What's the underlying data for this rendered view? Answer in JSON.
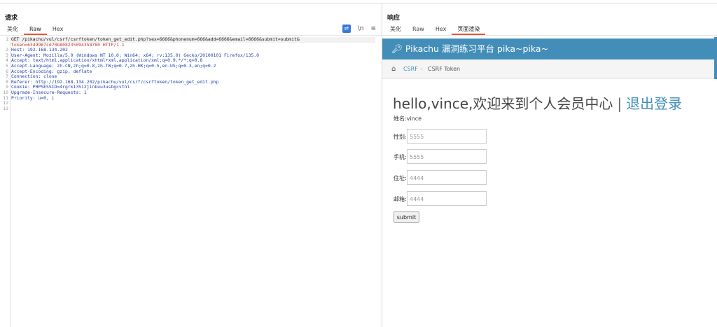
{
  "request": {
    "title": "请求",
    "tabs": [
      "美化",
      "Raw",
      "Hex"
    ],
    "active_tab": "Raw",
    "tool_newline": "\\n",
    "tool_menu": "≡",
    "lines": [
      {
        "num": "1",
        "text": "GET /pikachu/vul/csrf/csrftoken/token_get_edit.php?sex=6666&phonenum=666&add=6666&email=6666&submit=submit&"
      },
      {
        "num": "",
        "text": "token=6349967cd70b808235094358780 HTTP/1.1"
      },
      {
        "num": "2",
        "text": "Host: 192.168.134.202"
      },
      {
        "num": "3",
        "text": "User-Agent: Mozilla/5.0 (Windows NT 10.0; Win64; x64; rv:135.0) Gecko/20100101 Firefox/135.0"
      },
      {
        "num": "4",
        "text": "Accept: text/html,application/xhtml+xml,application/xml;q=0.9,*/*;q=0.8"
      },
      {
        "num": "5",
        "text": "Accept-Language: zh-CN,zh;q=0.8,zh-TW;q=0.7,zh-HK;q=0.5,en-US;q=0.3,en;q=0.2"
      },
      {
        "num": "6",
        "text": "Accept-Encoding: gzip, deflate"
      },
      {
        "num": "7",
        "text": "Connection: close"
      },
      {
        "num": "8",
        "text": "Referer: http://192.168.134.202/pikachu/vul/csrf/csrftoken/token_get_edit.php"
      },
      {
        "num": "9",
        "text": "Cookie: PHPSESSID=4rgrk135i2jinbuu3usbgcvthl"
      },
      {
        "num": "10",
        "text": "Upgrade-Insecure-Requests: 1"
      },
      {
        "num": "11",
        "text": "Priority: u=0, i"
      },
      {
        "num": "12",
        "text": ""
      },
      {
        "num": "13",
        "text": ""
      }
    ]
  },
  "response": {
    "title": "响应",
    "tabs": [
      "美化",
      "Raw",
      "Hex",
      "页面渲染"
    ],
    "active_tab": "页面渲染",
    "page": {
      "brand": "Pikachu 漏洞练习平台 pika~pika~",
      "crumb_1": "CSRF",
      "crumb_2": "CSRF Token",
      "greeting": "hello,vince,欢迎来到个人会员中心",
      "separator": "|",
      "logout": "退出登录",
      "name_label": "姓名:vince",
      "fields": [
        {
          "label": "性别:",
          "value": "5555"
        },
        {
          "label": "手机:",
          "value": "5555"
        },
        {
          "label": "住址:",
          "value": "4444"
        },
        {
          "label": "邮箱:",
          "value": "4444"
        }
      ],
      "submit": "submit"
    }
  },
  "colors": {
    "accent": "#e8542f",
    "navbar": "#438eb9",
    "link": "#438eb9"
  }
}
